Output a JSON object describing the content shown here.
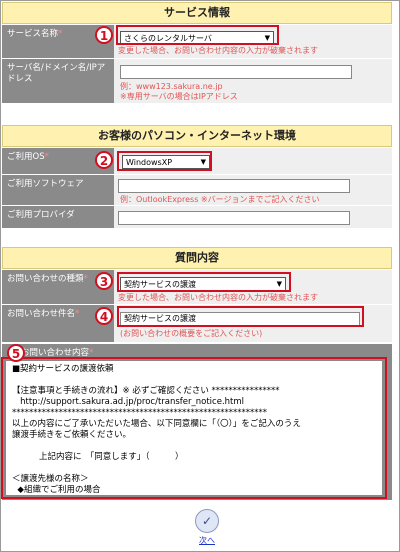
{
  "service": {
    "title": "サービス情報",
    "name_label": "サービス名称",
    "name_required_mark": "*",
    "name_value": "さくらのレンタルサーバ",
    "name_hint": "変更した場合、お問い合わせ内容の入力が破棄されます",
    "server_label": "サーバ名/ドメイン名/IPアドレス",
    "server_hint1": "例：www123.sakura.ne.jp",
    "server_hint2": "※専用サーバの場合はIPアドレス"
  },
  "env": {
    "title": "お客様のパソコン・インターネット環境",
    "os_label": "ご利用OS",
    "os_required_mark": "*",
    "os_value": "WindowsXP",
    "software_label": "ご利用ソフトウェア",
    "software_hint": "例：OutlookExpress ※バージョンまでご記入ください",
    "provider_label": "ご利用プロバイダ"
  },
  "question": {
    "title": "質問内容",
    "type_label": "お問い合わせの種類",
    "type_required_mark": "*",
    "type_value": "契約サービスの譲渡",
    "type_hint": "変更した場合、お問い合わせ内容の入力が破棄されます",
    "subject_label": "お問い合わせ件名",
    "subject_required_mark": "*",
    "subject_value": "契約サービスの譲渡",
    "subject_hint": "(お問い合わせの概要をご記入ください)",
    "content_label": "お問い合わせ内容",
    "content_required_mark": "*",
    "content_text": "■契約サービスの譲渡依頼\n\n【注意事項と手続きの流れ】※ 必ずご確認ください ****************\n   http://support.sakura.ad.jp/proc/transfer_notice.html\n************************************************************\n以上の内容にご了承いただいた場合、以下同意欄に「（〇）」をご記入のうえ\n譲渡手続きをご依頼ください。\n\n          上記内容に　「同意します」（　　　）\n\n＜譲渡先様の名称＞\n  ◆組織でご利用の場合"
  },
  "badges": [
    "1",
    "2",
    "3",
    "4",
    "5"
  ],
  "next_label": "次へ"
}
